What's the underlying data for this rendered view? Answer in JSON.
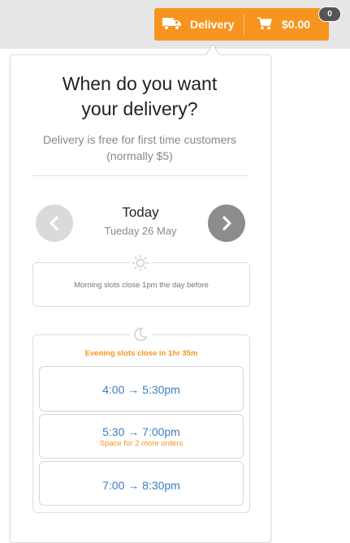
{
  "header": {
    "delivery_label": "Delivery",
    "cart_total": "$0.00",
    "cart_count": "0",
    "accent_color": "#f7941d"
  },
  "panel": {
    "title_line1": "When do you want",
    "title_line2": "your delivery?",
    "subtitle_line1": "Delivery is free for first time customers",
    "subtitle_line2": "(normally $5)"
  },
  "day": {
    "name": "Today",
    "date": "Tueday 26 May",
    "prev_icon": "chevron-left-icon",
    "next_icon": "chevron-right-icon"
  },
  "morning": {
    "icon": "sun-icon",
    "note": "Morning slots close 1pm the day before"
  },
  "evening": {
    "icon": "moon-icon",
    "note": "Evening slots close in 1hr 35m",
    "slots": [
      {
        "time": "4:00 → 5:30pm",
        "note": ""
      },
      {
        "time": "5:30 → 7:00pm",
        "note": "Space for 2 more orders"
      },
      {
        "time": "7:00 → 8:30pm",
        "note": ""
      }
    ]
  }
}
